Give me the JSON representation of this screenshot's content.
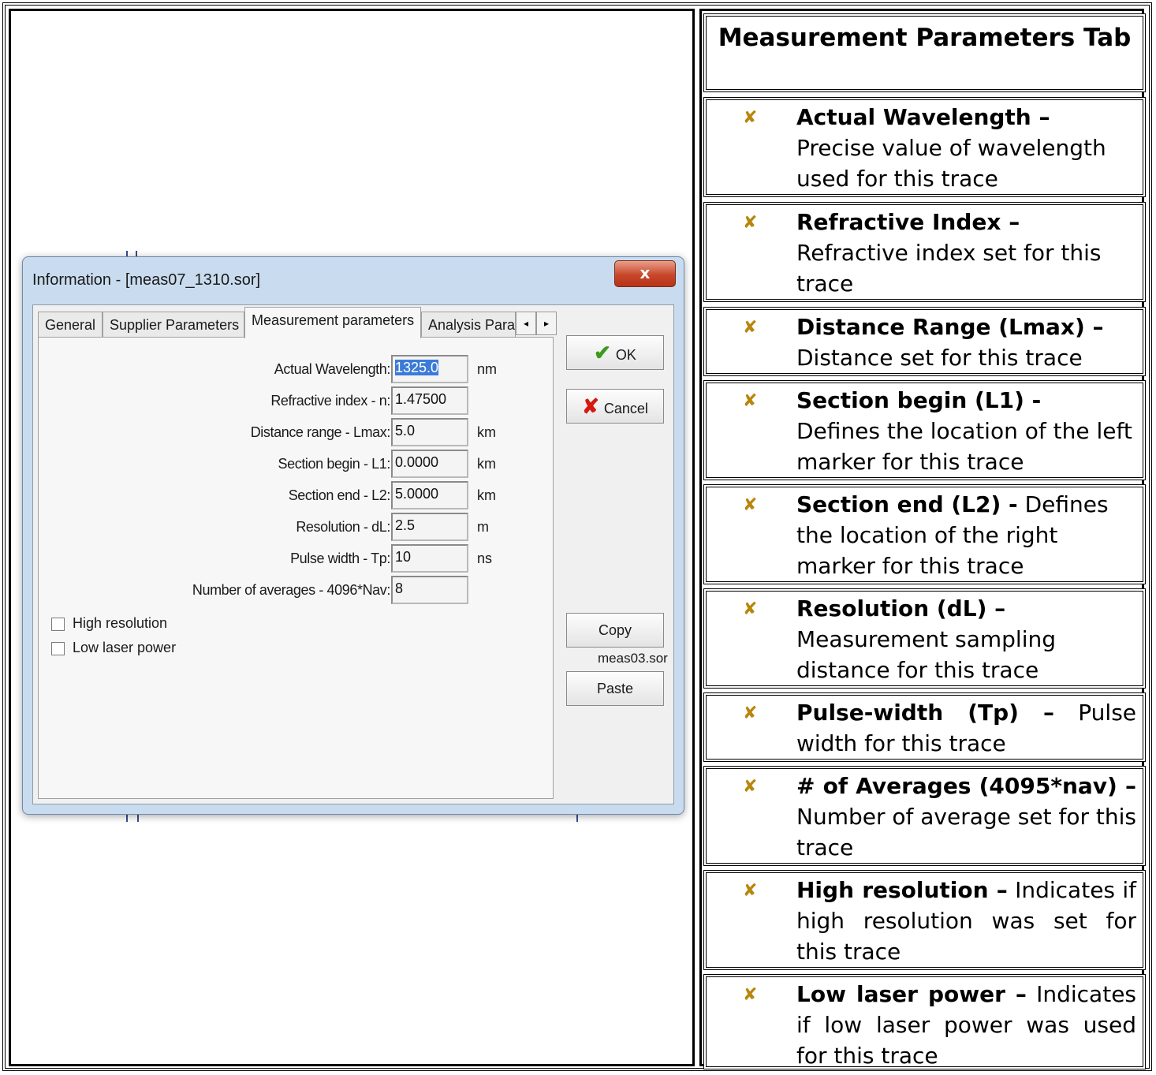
{
  "dialog": {
    "title": "Information - [meas07_1310.sor]",
    "close_label": "x",
    "tabs": [
      "General",
      "Supplier Parameters",
      "Measurement parameters",
      "Analysis Para"
    ],
    "tab_left_arrow": "◂",
    "tab_right_arrow": "▸",
    "fields": [
      {
        "label": "Actual Wavelength:",
        "value": "1325.0",
        "unit": "nm"
      },
      {
        "label": "Refractive index - n:",
        "value": "1.47500",
        "unit": ""
      },
      {
        "label": "Distance range - Lmax:",
        "value": "5.0",
        "unit": "km"
      },
      {
        "label": "Section begin - L1:",
        "value": "0.0000",
        "unit": "km"
      },
      {
        "label": "Section end - L2:",
        "value": "5.0000",
        "unit": "km"
      },
      {
        "label": "Resolution - dL:",
        "value": "2.5",
        "unit": "m"
      },
      {
        "label": "Pulse width - Tp:",
        "value": "10",
        "unit": "ns"
      },
      {
        "label": "Number of averages - 4096*Nav:",
        "value": "8",
        "unit": ""
      }
    ],
    "checkboxes": [
      "High resolution",
      "Low laser power"
    ],
    "buttons": {
      "ok": "OK",
      "cancel": "Cancel",
      "copy": "Copy",
      "paste": "Paste"
    },
    "copy_file": "meas03.sor"
  },
  "help": {
    "header": "Measurement Parameters Tab",
    "bullet_symbol": "✘",
    "items": [
      {
        "title": "Actual Wavelength –",
        "text": "Precise value of wavelength used for this trace"
      },
      {
        "title": "Refractive Index –",
        "text": "Refractive index set for this trace"
      },
      {
        "title": "Distance Range (Lmax) –",
        "text": "Distance set for this trace"
      },
      {
        "title": "Section begin (L1) -",
        "text": "Defines the location of the left marker for this trace"
      },
      {
        "title": "Section end (L2) -",
        "text": "Defines the location of the right marker for this trace"
      },
      {
        "title": "Resolution (dL) –",
        "text": "Measurement sampling distance for this trace"
      },
      {
        "title": "Pulse-width (Tp) –",
        "text": "Pulse width for this trace"
      },
      {
        "title": "# of Averages (4095*nav) –",
        "text": "Number of average set for this trace"
      },
      {
        "title": "High resolution –",
        "text": "Indicates if high resolution was set for this trace"
      },
      {
        "title": "Low laser power –",
        "text": "Indicates if low laser power was used for this trace"
      }
    ]
  }
}
